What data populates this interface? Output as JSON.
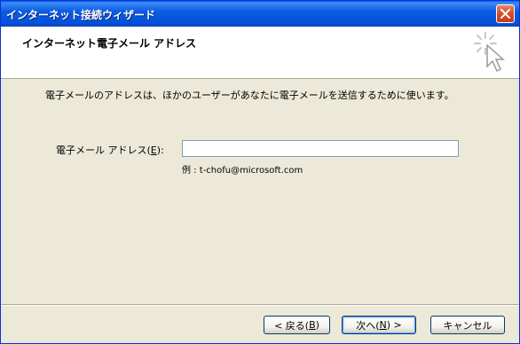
{
  "window": {
    "title": "インターネット接続ウィザード"
  },
  "header": {
    "title": "インターネット電子メール アドレス",
    "icon": "wizard-wand-icon"
  },
  "main": {
    "instruction": "電子メールのアドレスは、ほかのユーザーがあなたに電子メールを送信するために使います。",
    "email_label": "電子メール アドレス(",
    "email_mnemonic": "E",
    "email_label_end": "):",
    "email_value": "",
    "example": "例 : t-chofu@microsoft.com"
  },
  "buttons": {
    "back_prefix": "< 戻る(",
    "back_mnemonic": "B",
    "back_suffix": ")",
    "next_prefix": "次へ(",
    "next_mnemonic": "N",
    "next_suffix": ") >",
    "cancel": "キャンセル"
  },
  "colors": {
    "titlebar": "#0054e3",
    "face": "#ece9d8",
    "header_bg": "#ffffff"
  }
}
